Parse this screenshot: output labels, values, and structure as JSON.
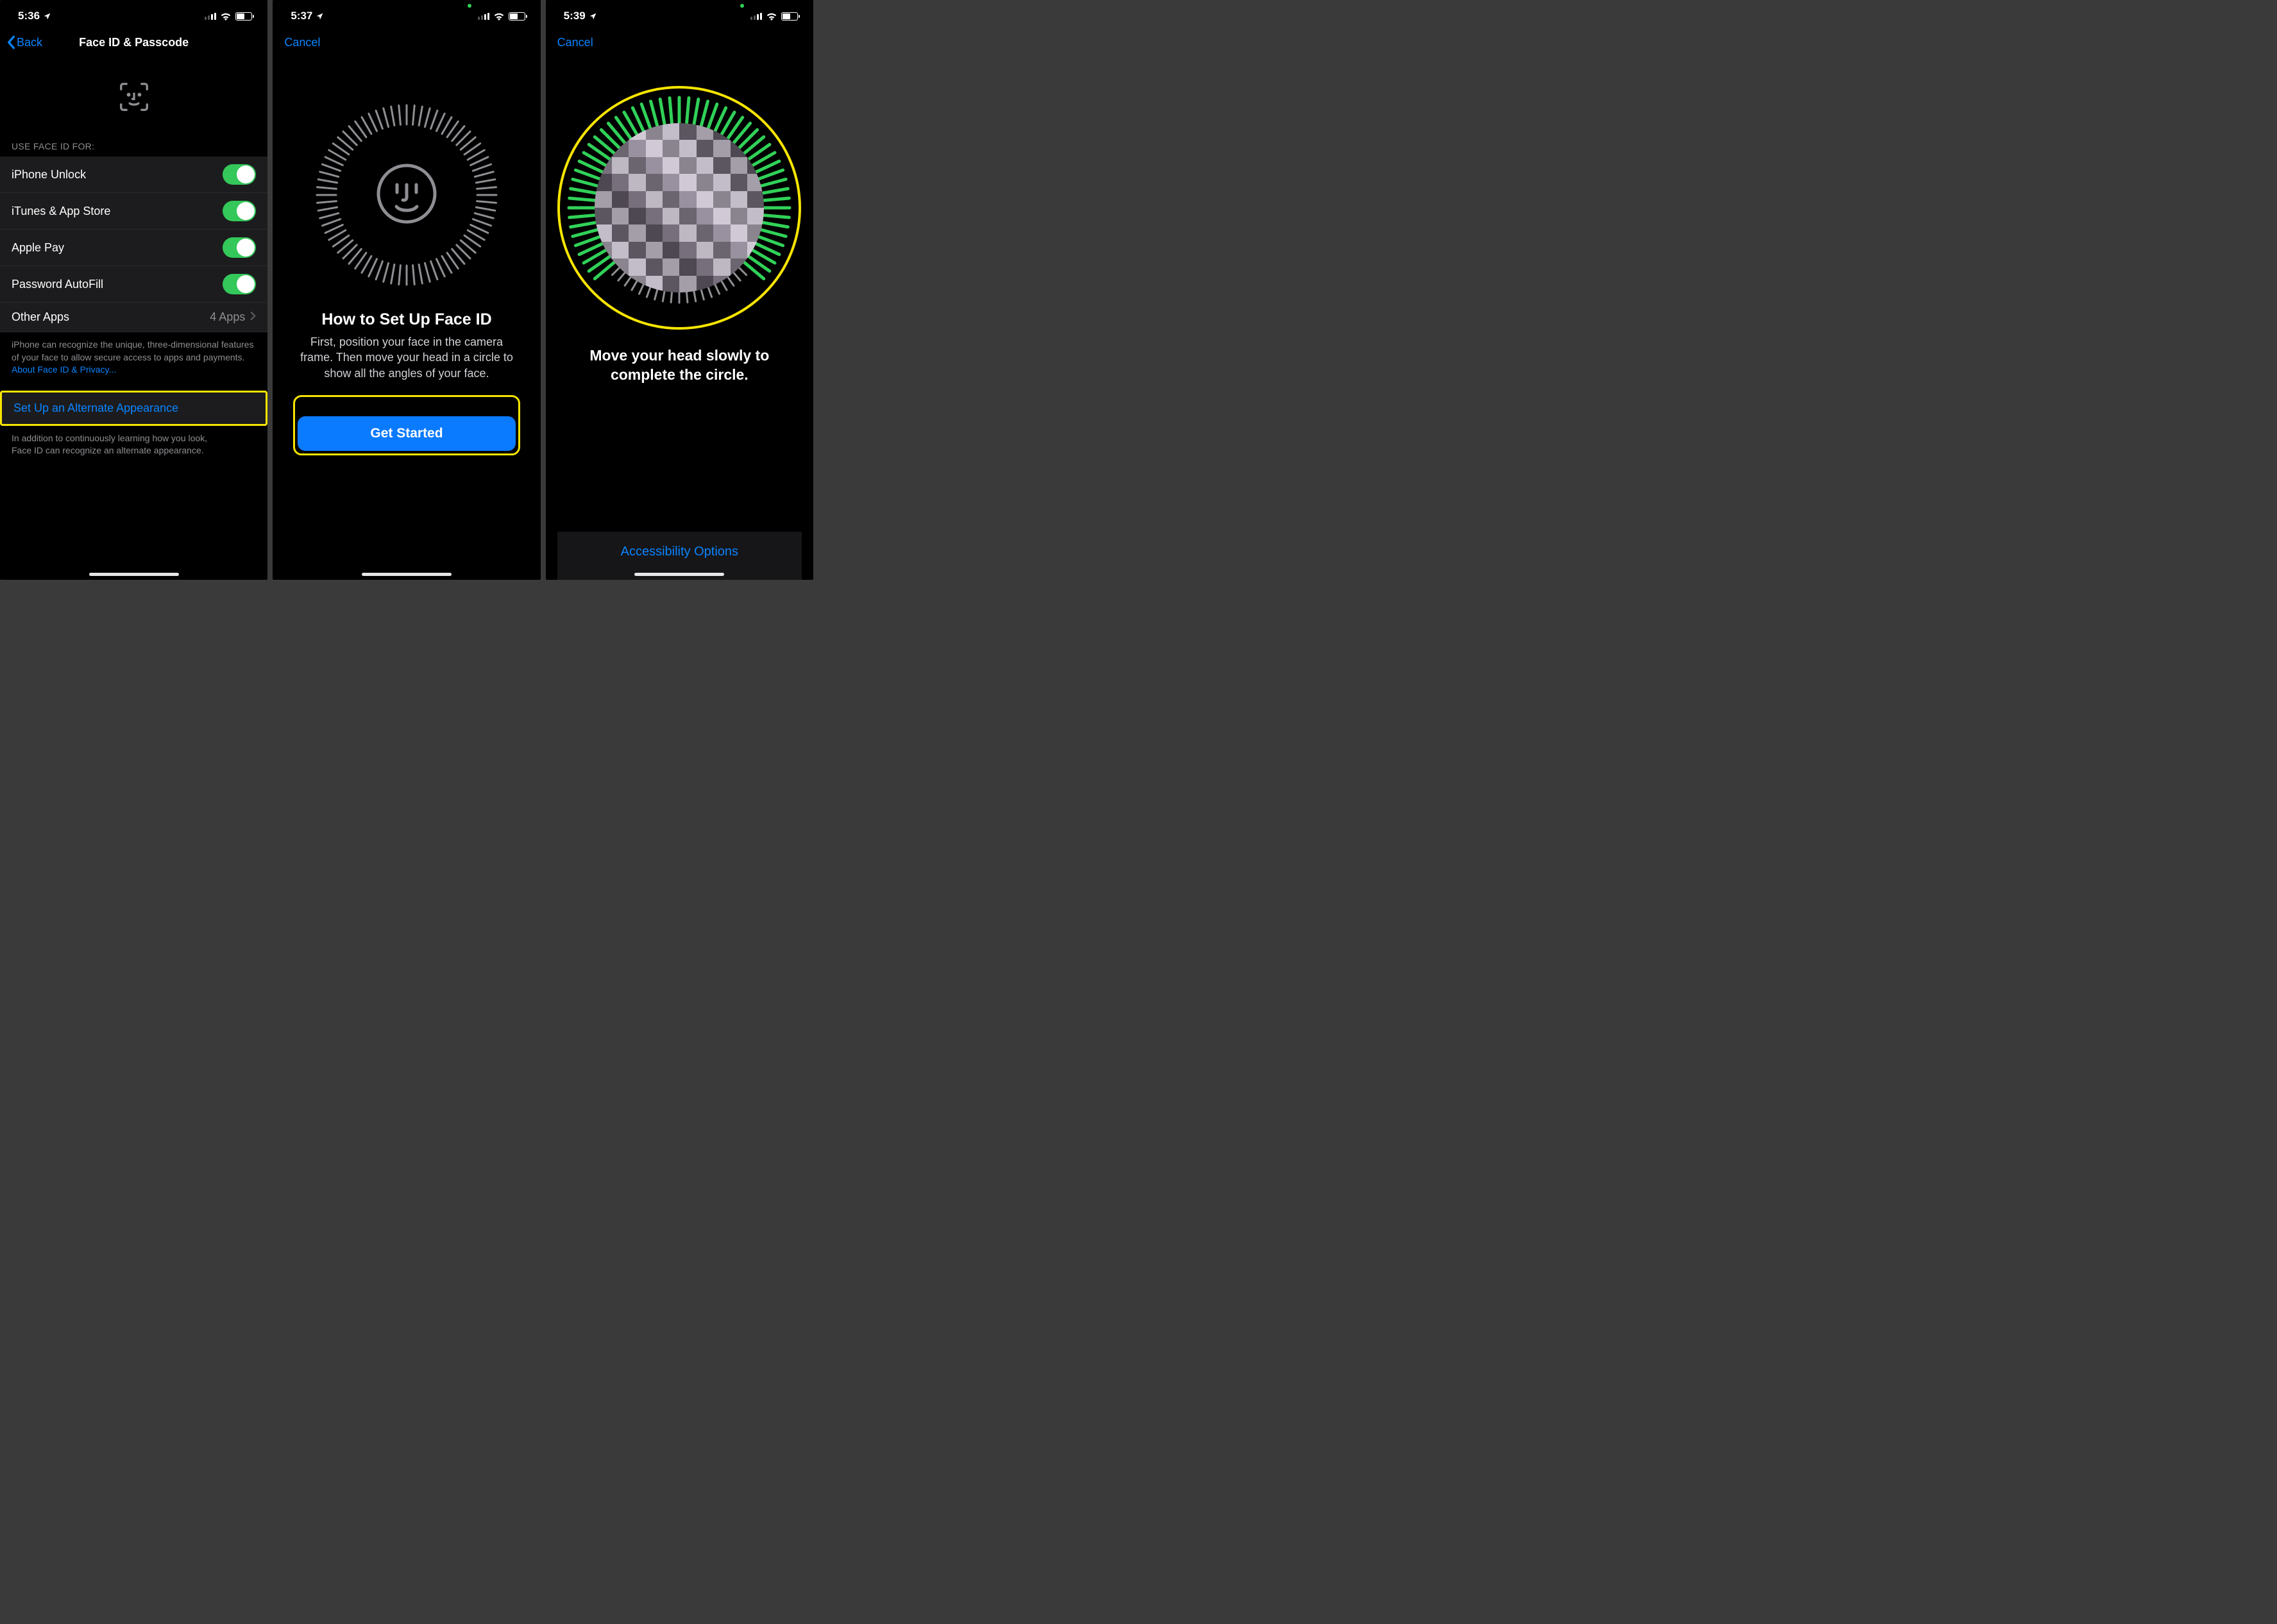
{
  "screen1": {
    "time": "5:36",
    "back": "Back",
    "title": "Face ID & Passcode",
    "section_header": "USE FACE ID FOR:",
    "rows": {
      "r0": "iPhone Unlock",
      "r1": "iTunes & App Store",
      "r2": "Apple Pay",
      "r3": "Password AutoFill",
      "r4": "Other Apps",
      "r4_detail": "4 Apps"
    },
    "footer1": "iPhone can recognize the unique, three-dimensional features of your face to allow secure access to apps and payments.",
    "footer_link": "About Face ID & Privacy...",
    "alt_appearance": "Set Up an Alternate Appearance",
    "footer2a": "In addition to continuously learning how you look,",
    "footer2b": "Face ID can recognize an alternate appearance."
  },
  "screen2": {
    "time": "5:37",
    "cancel": "Cancel",
    "heading": "How to Set Up Face ID",
    "body": "First, position your face in the camera frame. Then move your head in a circle to show all the angles of your face.",
    "button": "Get Started"
  },
  "screen3": {
    "time": "5:39",
    "cancel": "Cancel",
    "instruction": "Move your head slowly to complete the circle.",
    "accessibility": "Accessibility Options"
  }
}
